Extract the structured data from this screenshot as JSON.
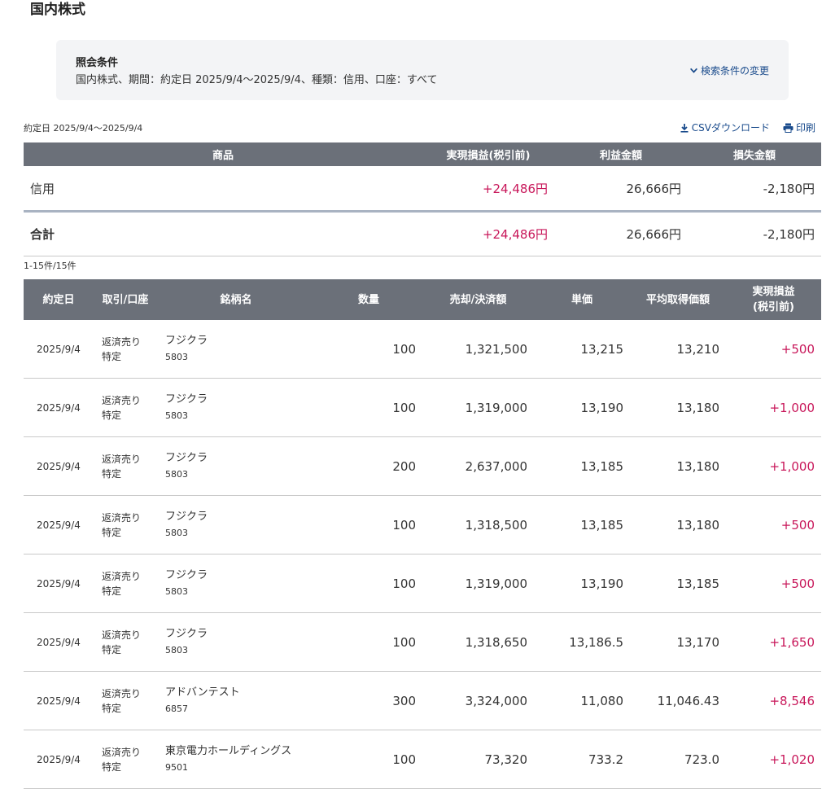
{
  "page_title": "国内株式",
  "conditions": {
    "title": "照会条件",
    "text": "国内株式、期間：約定日 2025/9/4〜2025/9/4、種類：信用、口座：すべて",
    "change_label": "検索条件の変更"
  },
  "date_range": "約定日 2025/9/4〜2025/9/4",
  "tools": {
    "csv_label": "CSVダウンロード",
    "print_label": "印刷"
  },
  "summary": {
    "headers": [
      "商品",
      "実現損益(税引前)",
      "利益金額",
      "損失金額"
    ],
    "rows": [
      {
        "product": "信用",
        "realized": "+24,486円",
        "profit": "26,666円",
        "loss": "-2,180円"
      }
    ],
    "total": {
      "label": "合計",
      "realized": "+24,486円",
      "profit": "26,666円",
      "loss": "-2,180円"
    }
  },
  "count_text": "1-15件/15件",
  "detail": {
    "headers": [
      "約定日",
      "取引/口座",
      "銘柄名",
      "数量",
      "売却/決済額",
      "単価",
      "平均取得価額",
      "実現損益",
      "(税引前)"
    ],
    "rows": [
      {
        "date": "2025/9/4",
        "trade": "返済売り",
        "account": "特定",
        "name": "フジクラ",
        "code": "5803",
        "qty": "100",
        "amount": "1,321,500",
        "price": "13,215",
        "avg": "13,210",
        "pl": "+500"
      },
      {
        "date": "2025/9/4",
        "trade": "返済売り",
        "account": "特定",
        "name": "フジクラ",
        "code": "5803",
        "qty": "100",
        "amount": "1,319,000",
        "price": "13,190",
        "avg": "13,180",
        "pl": "+1,000"
      },
      {
        "date": "2025/9/4",
        "trade": "返済売り",
        "account": "特定",
        "name": "フジクラ",
        "code": "5803",
        "qty": "200",
        "amount": "2,637,000",
        "price": "13,185",
        "avg": "13,180",
        "pl": "+1,000"
      },
      {
        "date": "2025/9/4",
        "trade": "返済売り",
        "account": "特定",
        "name": "フジクラ",
        "code": "5803",
        "qty": "100",
        "amount": "1,318,500",
        "price": "13,185",
        "avg": "13,180",
        "pl": "+500"
      },
      {
        "date": "2025/9/4",
        "trade": "返済売り",
        "account": "特定",
        "name": "フジクラ",
        "code": "5803",
        "qty": "100",
        "amount": "1,319,000",
        "price": "13,190",
        "avg": "13,185",
        "pl": "+500"
      },
      {
        "date": "2025/9/4",
        "trade": "返済売り",
        "account": "特定",
        "name": "フジクラ",
        "code": "5803",
        "qty": "100",
        "amount": "1,318,650",
        "price": "13,186.5",
        "avg": "13,170",
        "pl": "+1,650"
      },
      {
        "date": "2025/9/4",
        "trade": "返済売り",
        "account": "特定",
        "name": "アドバンテスト",
        "code": "6857",
        "qty": "300",
        "amount": "3,324,000",
        "price": "11,080",
        "avg": "11,046.43",
        "pl": "+8,546"
      },
      {
        "date": "2025/9/4",
        "trade": "返済売り",
        "account": "特定",
        "name": "東京電力ホールディングス",
        "code": "9501",
        "qty": "100",
        "amount": "73,320",
        "price": "733.2",
        "avg": "723.0",
        "pl": "+1,020"
      }
    ]
  },
  "colors": {
    "header_bg": "#6b7079",
    "positive": "#c8175a",
    "link": "#1a4b8c",
    "cond_bg": "#f3f4f6"
  },
  "icons": {
    "change": "chevron-down-icon",
    "csv": "download-icon",
    "print": "printer-icon"
  }
}
